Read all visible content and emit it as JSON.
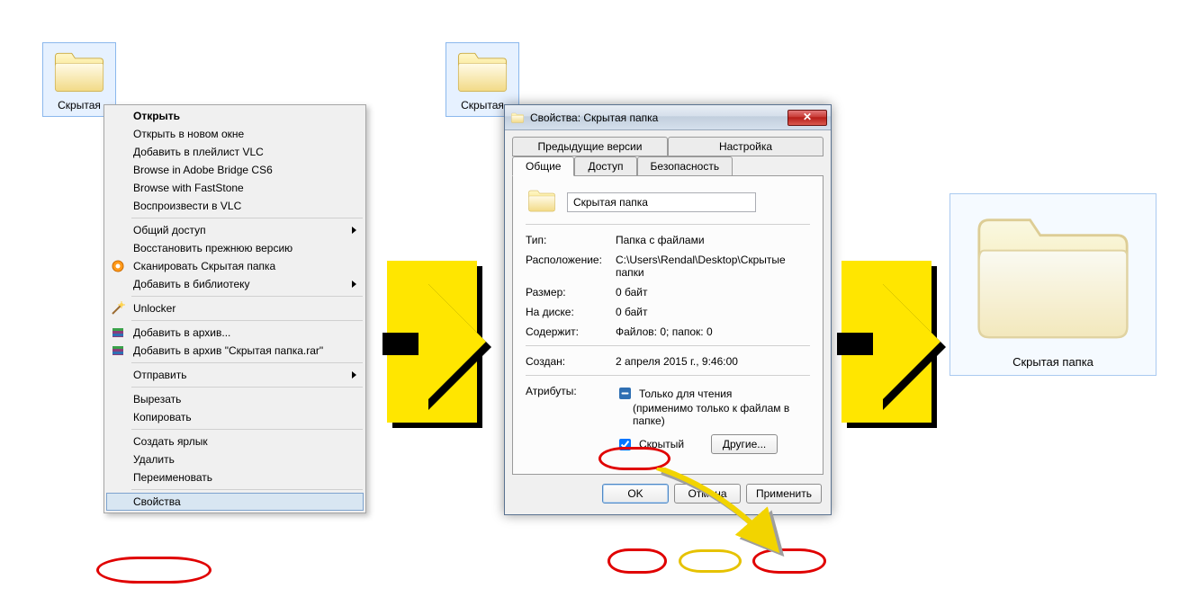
{
  "left_folder": {
    "label": "Скрытая"
  },
  "mid_folder": {
    "label": "Скрытая"
  },
  "right_folder": {
    "label": "Скрытая папка"
  },
  "context_menu": {
    "open": "Открыть",
    "open_new": "Открыть в новом окне",
    "add_vlc": "Добавить в плейлист VLC",
    "browse_bridge": "Browse in Adobe Bridge CS6",
    "browse_faststone": "Browse with FastStone",
    "play_vlc": "Воспроизвести в VLC",
    "share": "Общий доступ",
    "restore": "Восстановить прежнюю версию",
    "scan": "Сканировать Скрытая папка",
    "add_library": "Добавить в библиотеку",
    "unlocker": "Unlocker",
    "add_archive": "Добавить в архив...",
    "add_archive_named": "Добавить в архив \"Скрытая папка.rar\"",
    "send_to": "Отправить",
    "cut": "Вырезать",
    "copy": "Копировать",
    "create_shortcut": "Создать ярлык",
    "delete": "Удалить",
    "rename": "Переименовать",
    "properties": "Свойства"
  },
  "dialog": {
    "title": "Свойства: Скрытая папка",
    "tabs_top": {
      "prev": "Предыдущие версии",
      "settings": "Настройка"
    },
    "tabs_bottom": {
      "general": "Общие",
      "access": "Доступ",
      "security": "Безопасность"
    },
    "name_value": "Скрытая папка",
    "fields": {
      "type_k": "Тип:",
      "type_v": "Папка с файлами",
      "loc_k": "Расположение:",
      "loc_v": "C:\\Users\\Rendal\\Desktop\\Скрытые папки",
      "size_k": "Размер:",
      "size_v": "0 байт",
      "ondisk_k": "На диске:",
      "ondisk_v": "0 байт",
      "contains_k": "Содержит:",
      "contains_v": "Файлов: 0; папок: 0",
      "created_k": "Создан:",
      "created_v": "2 апреля 2015 г., 9:46:00",
      "attrs_k": "Атрибуты:",
      "readonly_label": "Только для чтения",
      "readonly_note": "(применимо только к файлам в папке)",
      "hidden_label": "Скрытый",
      "others_btn": "Другие..."
    },
    "buttons": {
      "ok": "OK",
      "cancel": "Отмена",
      "apply": "Применить"
    }
  }
}
